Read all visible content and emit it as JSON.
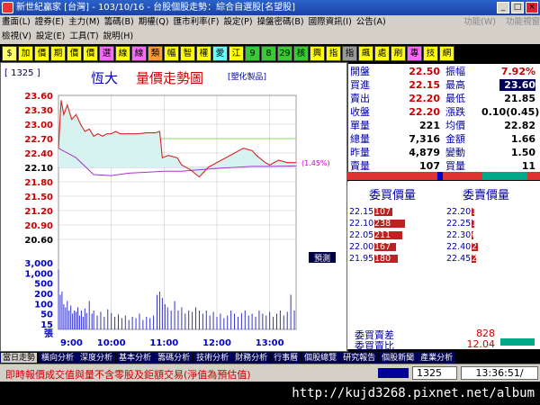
{
  "window": {
    "title": "新世紀贏家 [台灣] - 103/10/16 - 台股個股走勢：綜合自選股[名望股]",
    "buttons": [
      "_",
      "□",
      "×"
    ]
  },
  "menu": {
    "row1": [
      "畫面(L)",
      "證券(E)",
      "主力(M)",
      "籌碼(B)",
      "期權(Q)",
      "匯市利率(F)",
      "設定(P)",
      "操盤密碼(B)",
      "國際資訊(I)",
      "公告(A)"
    ],
    "row2": [
      "檢視(V)",
      "設定(E)",
      "工具(T)",
      "說明(H)"
    ],
    "right": [
      "功能(W)",
      "功能視窗"
    ]
  },
  "toolbar": {
    "buttons": [
      {
        "label": "$",
        "bg": "#ffff66"
      },
      {
        "label": "加",
        "bg": "#ffff00"
      },
      {
        "label": "價",
        "bg": "#ffff00"
      },
      {
        "label": "期",
        "bg": "#ffff00"
      },
      {
        "label": "價",
        "bg": "#ffff00"
      },
      {
        "label": "價",
        "bg": "#ffff00"
      },
      {
        "label": "選",
        "bg": "#ff66ff"
      },
      {
        "label": "線",
        "bg": "#ffff00"
      },
      {
        "label": "線",
        "bg": "#ff66ff"
      },
      {
        "label": "類",
        "bg": "#ff9933"
      },
      {
        "label": "幅",
        "bg": "#ffff00"
      },
      {
        "label": "智",
        "bg": "#ffff00"
      },
      {
        "label": "權",
        "bg": "#ffff00"
      },
      {
        "label": "愛",
        "bg": "#66ffff"
      },
      {
        "label": "江",
        "bg": "#ffff00"
      },
      {
        "label": "9",
        "bg": "#33cc33"
      },
      {
        "label": "8",
        "bg": "#33cc33"
      },
      {
        "label": "29",
        "bg": "#33cc33"
      },
      {
        "label": "核",
        "bg": "#33cc33"
      },
      {
        "label": "興",
        "bg": "#ffff00"
      },
      {
        "label": "指",
        "bg": "#ffff00"
      },
      {
        "label": "指",
        "bg": "#999999"
      },
      {
        "label": "飆",
        "bg": "#ffff00"
      },
      {
        "label": "處",
        "bg": "#ffff00"
      },
      {
        "label": "刷",
        "bg": "#ffff00"
      },
      {
        "label": "專",
        "bg": "#ff66ff"
      },
      {
        "label": "技",
        "bg": "#ffff00"
      },
      {
        "label": "網",
        "bg": "#ffff00"
      }
    ]
  },
  "header": {
    "code": "[ 1325 ]",
    "name": "恆大",
    "chart_title": "量價走勢圖",
    "industry": "[塑化製品]"
  },
  "quote": {
    "left": [
      {
        "label": "開盤",
        "value": "22.50",
        "color": "#c00"
      },
      {
        "label": "買進",
        "value": "22.15",
        "color": "#c00"
      },
      {
        "label": "賣出",
        "value": "22.20",
        "color": "#c00"
      },
      {
        "label": "收盤",
        "value": "22.20",
        "color": "#c00"
      },
      {
        "label": "單量",
        "value": "221",
        "color": "#000"
      },
      {
        "label": "總量",
        "value": "7,316",
        "color": "#000"
      },
      {
        "label": "昨量",
        "value": "4,879",
        "color": "#000"
      },
      {
        "label": "賣量",
        "value": "107",
        "color": "#000"
      }
    ],
    "right": [
      {
        "label": "振幅",
        "value": "7.92%",
        "color": "#c00"
      },
      {
        "label": "最高",
        "value": "23.60",
        "color": "#fff",
        "bg": "#005"
      },
      {
        "label": "最低",
        "value": "21.85",
        "color": "#000"
      },
      {
        "label": "漲跌",
        "value": "0.10(0.45)",
        "color": "#000"
      },
      {
        "label": "均價",
        "value": "22.82",
        "color": "#000"
      },
      {
        "label": "金額",
        "value": "1.66",
        "color": "#000"
      },
      {
        "label": "變動",
        "value": "1.50",
        "color": "#000"
      },
      {
        "label": "買量",
        "value": "11",
        "color": "#000"
      }
    ]
  },
  "book": {
    "bid_header": "委買價量",
    "ask_header": "委賣價量",
    "bids": [
      {
        "price": "22.15",
        "qty": "107",
        "bar": 0.6
      },
      {
        "price": "22.10",
        "qty": "238",
        "bar": 1.0
      },
      {
        "price": "22.05",
        "qty": "211",
        "bar": 0.9
      },
      {
        "price": "22.00",
        "qty": "167",
        "bar": 0.72
      },
      {
        "price": "21.95",
        "qty": "180",
        "bar": 0.76
      }
    ],
    "asks": [
      {
        "price": "22.20",
        "qty": "11",
        "bar": 0.08
      },
      {
        "price": "22.25",
        "qty": "12",
        "bar": 0.09
      },
      {
        "price": "22.30",
        "qty": "6",
        "bar": 0.05
      },
      {
        "price": "22.40",
        "qty": "27",
        "bar": 0.2
      },
      {
        "price": "22.45",
        "qty": "20",
        "bar": 0.15
      }
    ],
    "diff_label": "委買賣差",
    "diff_value": "828",
    "ratio_label": "委買賣比",
    "ratio_value": "12.04"
  },
  "chart_data": {
    "type": "line",
    "price_ticks": [
      "23.60",
      "23.30",
      "23.00",
      "22.70",
      "22.40",
      "22.10",
      "21.80",
      "21.50",
      "21.20",
      "20.90",
      "20.60"
    ],
    "ylim": [
      20.6,
      23.6
    ],
    "volume_ticks": [
      "3,000",
      "1,000",
      "500",
      "200",
      "100",
      "50",
      "15"
    ],
    "volume_unit": "張",
    "x_ticks": [
      "9:00",
      "10:00",
      "11:00",
      "12:00",
      "13:00"
    ],
    "ref_label": "(1.45%)",
    "prediction_label": "預測",
    "price": [
      [
        0,
        22.5
      ],
      [
        3,
        23.5
      ],
      [
        6,
        23.2
      ],
      [
        10,
        23.4
      ],
      [
        15,
        23.1
      ],
      [
        20,
        23.2
      ],
      [
        25,
        23.0
      ],
      [
        30,
        22.85
      ],
      [
        35,
        22.9
      ],
      [
        40,
        22.75
      ],
      [
        45,
        22.8
      ],
      [
        50,
        22.75
      ],
      [
        55,
        22.8
      ],
      [
        60,
        22.8
      ],
      [
        65,
        22.85
      ],
      [
        70,
        22.8
      ],
      [
        80,
        22.8
      ],
      [
        90,
        22.8
      ],
      [
        100,
        22.82
      ],
      [
        110,
        22.82
      ],
      [
        115,
        22.85
      ],
      [
        118,
        22.3
      ],
      [
        125,
        22.35
      ],
      [
        135,
        22.3
      ],
      [
        140,
        22.15
      ],
      [
        150,
        22.05
      ],
      [
        160,
        21.9
      ],
      [
        165,
        22.0
      ],
      [
        170,
        22.1
      ],
      [
        180,
        22.2
      ],
      [
        190,
        22.3
      ],
      [
        200,
        22.4
      ],
      [
        210,
        22.5
      ],
      [
        220,
        22.45
      ],
      [
        225,
        22.35
      ],
      [
        235,
        22.2
      ],
      [
        240,
        22.15
      ],
      [
        250,
        22.25
      ],
      [
        260,
        22.2
      ],
      [
        270,
        22.2
      ]
    ],
    "average": [
      [
        0,
        22.5
      ],
      [
        20,
        22.3
      ],
      [
        40,
        21.95
      ],
      [
        60,
        21.93
      ],
      [
        80,
        21.98
      ],
      [
        100,
        22.0
      ],
      [
        120,
        22.02
      ],
      [
        140,
        22.02
      ],
      [
        160,
        22.05
      ],
      [
        180,
        22.08
      ],
      [
        200,
        22.1
      ],
      [
        220,
        22.12
      ],
      [
        240,
        22.12
      ],
      [
        270,
        22.13
      ]
    ],
    "volume": [
      [
        0,
        0.95
      ],
      [
        2,
        0.55
      ],
      [
        4,
        0.6
      ],
      [
        6,
        0.4
      ],
      [
        8,
        0.35
      ],
      [
        10,
        0.45
      ],
      [
        12,
        0.3
      ],
      [
        14,
        0.38
      ],
      [
        16,
        0.25
      ],
      [
        18,
        0.3
      ],
      [
        20,
        0.28
      ],
      [
        22,
        0.35
      ],
      [
        24,
        0.22
      ],
      [
        26,
        0.3
      ],
      [
        28,
        0.2
      ],
      [
        30,
        0.33
      ],
      [
        32,
        0.26
      ],
      [
        35,
        0.45
      ],
      [
        38,
        0.25
      ],
      [
        40,
        0.3
      ],
      [
        44,
        0.22
      ],
      [
        48,
        0.28
      ],
      [
        52,
        0.2
      ],
      [
        56,
        0.32
      ],
      [
        60,
        0.26
      ],
      [
        64,
        0.2
      ],
      [
        68,
        0.24
      ],
      [
        72,
        0.18
      ],
      [
        76,
        0.22
      ],
      [
        80,
        0.15
      ],
      [
        84,
        0.2
      ],
      [
        88,
        0.18
      ],
      [
        92,
        0.25
      ],
      [
        96,
        0.15
      ],
      [
        100,
        0.2
      ],
      [
        104,
        0.18
      ],
      [
        108,
        0.22
      ],
      [
        112,
        0.55
      ],
      [
        115,
        0.6
      ],
      [
        118,
        0.5
      ],
      [
        121,
        0.4
      ],
      [
        124,
        0.35
      ],
      [
        128,
        0.3
      ],
      [
        132,
        0.45
      ],
      [
        136,
        0.3
      ],
      [
        140,
        0.35
      ],
      [
        144,
        0.25
      ],
      [
        148,
        0.3
      ],
      [
        152,
        0.28
      ],
      [
        156,
        0.35
      ],
      [
        160,
        0.3
      ],
      [
        164,
        0.25
      ],
      [
        168,
        0.3
      ],
      [
        172,
        0.22
      ],
      [
        176,
        0.28
      ],
      [
        180,
        0.2
      ],
      [
        184,
        0.25
      ],
      [
        188,
        0.18
      ],
      [
        192,
        0.22
      ],
      [
        196,
        0.3
      ],
      [
        200,
        0.25
      ],
      [
        204,
        0.2
      ],
      [
        208,
        0.26
      ],
      [
        212,
        0.3
      ],
      [
        216,
        0.22
      ],
      [
        220,
        0.25
      ],
      [
        224,
        0.2
      ],
      [
        228,
        0.3
      ],
      [
        232,
        0.25
      ],
      [
        236,
        0.22
      ],
      [
        240,
        0.28
      ],
      [
        244,
        0.2
      ],
      [
        248,
        0.25
      ],
      [
        252,
        0.3
      ],
      [
        256,
        0.22
      ],
      [
        260,
        0.28
      ],
      [
        264,
        0.55
      ],
      [
        268,
        0.3
      ]
    ]
  },
  "bottom_tabs": [
    "當日走勢",
    "橫向分析",
    "深度分析",
    "基本分析",
    "籌碼分析",
    "技術分析",
    "財務分析",
    "行事曆",
    "個股總覽",
    "研究報告",
    "個股新聞",
    "產業分析"
  ],
  "status": {
    "notice": "即時報價成交值與量不含零股及鉅額交易(淨值為預估值)",
    "code": "1325",
    "time": "13:36:51/"
  },
  "watermark": "http://kujd3268.pixnet.net/album"
}
